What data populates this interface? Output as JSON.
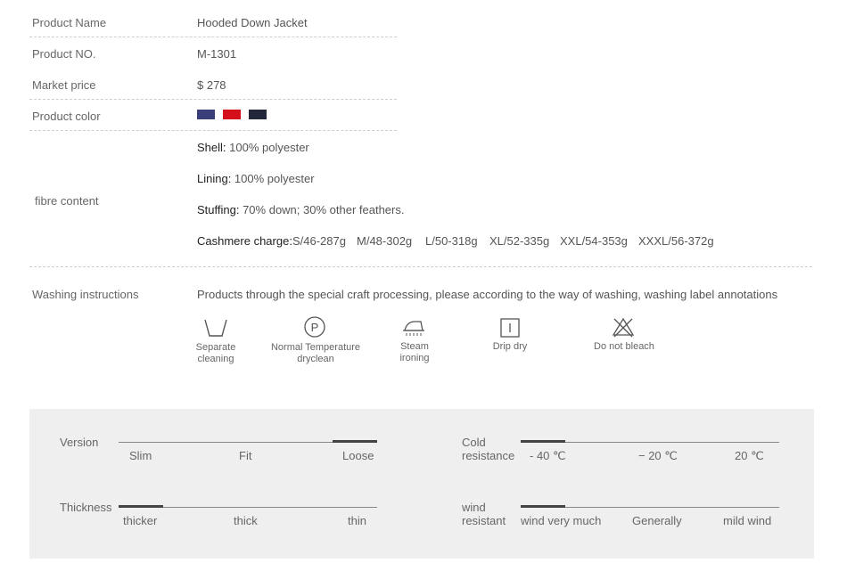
{
  "product": {
    "name_label": "Product  Name",
    "name_value": "Hooded  Down Jacket",
    "no_label": "Product NO.",
    "no_value": "M-1301",
    "price_label": "Market price",
    "price_value": "$ 278",
    "color_label": "Product color",
    "colors": [
      "#3a3f7a",
      "#d4101a",
      "#22283a"
    ]
  },
  "fibre": {
    "label": "fibre content",
    "shell_key": "Shell:",
    "shell_val": " 100% polyester",
    "lining_key": "Lining:",
    "lining_val": " 100% polyester",
    "stuffing_key": "Stuffing:",
    "stuffing_val": " 70% down; 30% other feathers.",
    "cashmere_key": "Cashmere charge:",
    "cashmere_sizes": [
      "S/46-287g",
      "M/48-302g",
      "L/50-318g",
      "XL/52-335g",
      "XXL/54-353g",
      "XXXL/56-372g"
    ]
  },
  "washing": {
    "label": "Washing instructions",
    "description": "Products through the special craft processing, please according to the way of washing, washing label annotations",
    "items": [
      {
        "icon": "hand-wash-basin-icon",
        "line1": "Separate",
        "line2": "cleaning"
      },
      {
        "icon": "dryclean-p-circle-icon",
        "line1": "Normal Temperature",
        "line2": "dryclean"
      },
      {
        "icon": "iron-steam-icon",
        "line1": "Steam",
        "line2": "ironing"
      },
      {
        "icon": "drip-dry-icon",
        "line1": "Drip dry",
        "line2": ""
      },
      {
        "icon": "no-bleach-icon",
        "line1": "Do not bleach",
        "line2": ""
      }
    ]
  },
  "attributes": {
    "version": {
      "label": "Version",
      "ticks": [
        "Slim",
        "Fit",
        "Loose"
      ],
      "selected": "Loose"
    },
    "thickness": {
      "label": "Thickness",
      "ticks": [
        "thicker",
        "thick",
        "thin"
      ],
      "selected": "thicker"
    },
    "cold": {
      "label1": "Cold",
      "label2": "resistance",
      "ticks": [
        "- 40 ℃",
        "− 20 ℃",
        "20 ℃"
      ],
      "selected": "- 40 ℃"
    },
    "wind": {
      "label1": "wind",
      "label2": "resistant",
      "ticks": [
        "wind very much",
        "Generally",
        "mild wind"
      ],
      "selected": "wind very much"
    }
  }
}
